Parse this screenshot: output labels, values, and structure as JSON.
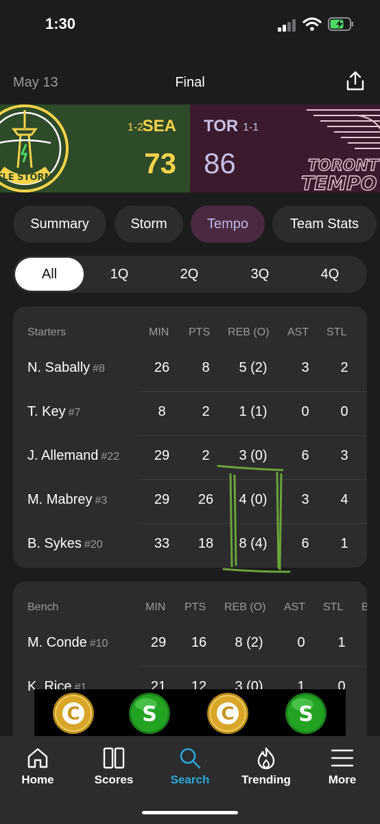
{
  "status_bar": {
    "time": "1:30"
  },
  "header": {
    "date": "May 13",
    "status": "Final"
  },
  "banner": {
    "home": {
      "record": "1-2",
      "abbr": "SEA",
      "score": "73",
      "logo_text": "TLE STORM",
      "color": "#f7d44a",
      "bg": "#2d4a29"
    },
    "away": {
      "abbr": "TOR",
      "record": "1-1",
      "score": "86",
      "logo_line1": "TORONT",
      "logo_line2": "TEMPO",
      "color": "#c6bfe3",
      "bg": "#3a1a2c"
    }
  },
  "tabs": [
    {
      "label": "Summary",
      "active": false
    },
    {
      "label": "Storm",
      "active": false
    },
    {
      "label": "Tempo",
      "active": true
    },
    {
      "label": "Team Stats",
      "active": false
    }
  ],
  "quarters": [
    {
      "label": "All",
      "active": true
    },
    {
      "label": "1Q",
      "active": false
    },
    {
      "label": "2Q",
      "active": false
    },
    {
      "label": "3Q",
      "active": false
    },
    {
      "label": "4Q",
      "active": false
    }
  ],
  "starters": {
    "title": "Starters",
    "columns": [
      "MIN",
      "PTS",
      "REB (O)",
      "AST",
      "STL"
    ],
    "rows": [
      {
        "name": "N. Sabally",
        "jersey": "#8",
        "min": "26",
        "pts": "8",
        "reb": "5 (2)",
        "ast": "3",
        "stl": "2"
      },
      {
        "name": "T. Key",
        "jersey": "#7",
        "min": "8",
        "pts": "2",
        "reb": "1 (1)",
        "ast": "0",
        "stl": "0"
      },
      {
        "name": "J. Allemand",
        "jersey": "#22",
        "min": "29",
        "pts": "2",
        "reb": "3 (0)",
        "ast": "6",
        "stl": "3"
      },
      {
        "name": "M. Mabrey",
        "jersey": "#3",
        "min": "29",
        "pts": "26",
        "reb": "4 (0)",
        "ast": "3",
        "stl": "4"
      },
      {
        "name": "B. Sykes",
        "jersey": "#20",
        "min": "33",
        "pts": "18",
        "reb": "8 (4)",
        "ast": "6",
        "stl": "1"
      }
    ]
  },
  "bench": {
    "title": "Bench",
    "columns": [
      "MIN",
      "PTS",
      "REB (O)",
      "AST",
      "STL",
      "B"
    ],
    "rows": [
      {
        "name": "M. Conde",
        "jersey": "#10",
        "min": "29",
        "pts": "16",
        "reb": "8 (2)",
        "ast": "0",
        "stl": "1"
      },
      {
        "name": "K. Rice",
        "jersey": "#1",
        "min": "21",
        "pts": "12",
        "reb": "3 (0)",
        "ast": "1",
        "stl": "0"
      }
    ]
  },
  "ad": {
    "coins": [
      "C",
      "S",
      "C",
      "S"
    ]
  },
  "nav": [
    {
      "label": "Home",
      "icon": "home-icon",
      "active": false
    },
    {
      "label": "Scores",
      "icon": "scores-icon",
      "active": false
    },
    {
      "label": "Search",
      "icon": "search-icon",
      "active": true
    },
    {
      "label": "Trending",
      "icon": "trending-icon",
      "active": false
    },
    {
      "label": "More",
      "icon": "more-icon",
      "active": false
    }
  ],
  "colors": {
    "accent": "#2aa8d8",
    "active_tab_bg": "#4a2a40",
    "annotation": "#6aa43a"
  }
}
